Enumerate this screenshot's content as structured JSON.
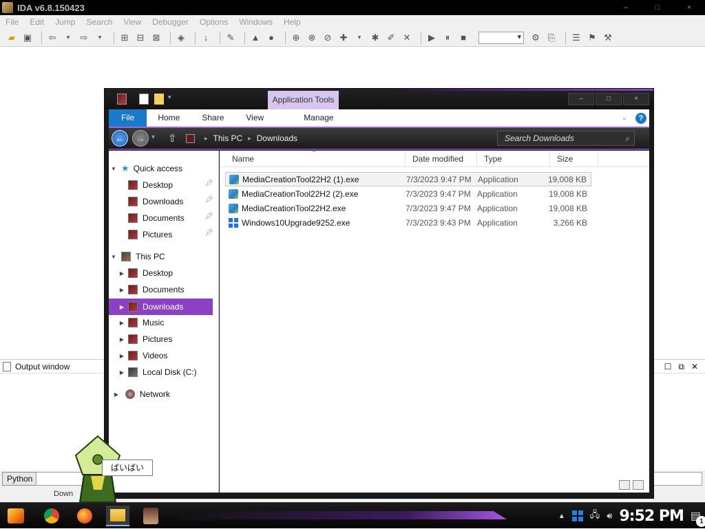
{
  "ida": {
    "title": "IDA v6.8.150423",
    "window_buttons": [
      "–",
      "□",
      "×"
    ],
    "menu": [
      "File",
      "Edit",
      "Jump",
      "Search",
      "View",
      "Debugger",
      "Options",
      "Windows",
      "Help"
    ],
    "output_window_title": "Output window",
    "python_button": "Python",
    "status_text": "Down"
  },
  "explorer": {
    "title": "Downloads",
    "contextual_tab": "Application Tools",
    "ribbon_tabs": {
      "file": "File",
      "home": "Home",
      "share": "Share",
      "view": "View",
      "manage": "Manage"
    },
    "window_buttons": [
      "–",
      "□",
      "×"
    ],
    "address": {
      "crumbs": [
        "This PC",
        "Downloads"
      ]
    },
    "search": {
      "placeholder": "Search Downloads"
    },
    "nav": {
      "quick_access": "Quick access",
      "qa_items": [
        "Desktop",
        "Downloads",
        "Documents",
        "Pictures"
      ],
      "this_pc": "This PC",
      "pc_items": [
        "Desktop",
        "Documents",
        "Downloads",
        "Music",
        "Pictures",
        "Videos",
        "Local Disk (C:)"
      ],
      "network": "Network",
      "selected": "Downloads"
    },
    "columns": {
      "name": "Name",
      "date": "Date modified",
      "type": "Type",
      "size": "Size"
    },
    "files": [
      {
        "name": "MediaCreationTool22H2 (1).exe",
        "date": "7/3/2023 9:47 PM",
        "type": "Application",
        "size": "19,008 KB",
        "icon": "media-creation-tool-icon"
      },
      {
        "name": "MediaCreationTool22H2 (2).exe",
        "date": "7/3/2023 9:47 PM",
        "type": "Application",
        "size": "19,008 KB",
        "icon": "media-creation-tool-icon"
      },
      {
        "name": "MediaCreationTool22H2.exe",
        "date": "7/3/2023 9:47 PM",
        "type": "Application",
        "size": "19,008 KB",
        "icon": "media-creation-tool-icon"
      },
      {
        "name": "Windows10Upgrade9252.exe",
        "date": "7/3/2023 9:43 PM",
        "type": "Application",
        "size": "3,266 KB",
        "icon": "windows-logo-icon"
      }
    ]
  },
  "mascot": {
    "speech": "ばいばい"
  },
  "taskbar": {
    "clock": "9:52 PM",
    "notification_count": "1"
  },
  "colors": {
    "accent_purple": "#8b41c4",
    "file_tab_blue": "#1979ca",
    "app_tools_tab": "#d9c6f0"
  }
}
